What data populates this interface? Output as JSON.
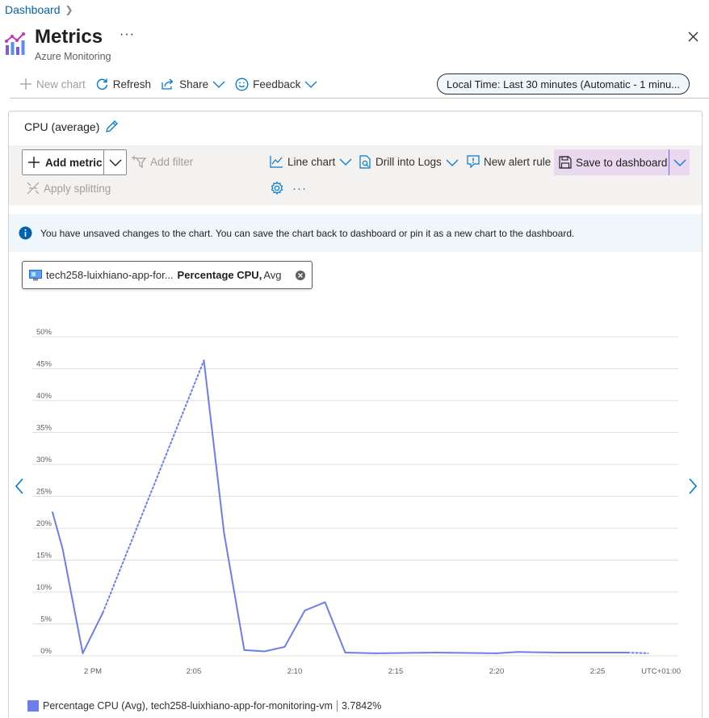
{
  "breadcrumb": {
    "item": "Dashboard"
  },
  "header": {
    "title": "Metrics",
    "subtitle": "Azure Monitoring",
    "more": "···"
  },
  "commandbar": {
    "new_chart": "New chart",
    "refresh": "Refresh",
    "share": "Share",
    "feedback": "Feedback",
    "time_range": "Local Time: Last 30 minutes (Automatic - 1 minu..."
  },
  "chart_card": {
    "title": "CPU (average)",
    "toolbar": {
      "add_metric": "Add metric",
      "add_filter": "Add filter",
      "line_chart": "Line chart",
      "drill_into_logs": "Drill into Logs",
      "new_alert_rule": "New alert rule",
      "save_to_dashboard": "Save to dashboard",
      "apply_splitting": "Apply splitting",
      "more": "···"
    },
    "banner": "You have unsaved changes to the chart. You can save the chart back to dashboard or pin it as a new chart to the dashboard.",
    "metric_pill": {
      "resource": "tech258-luixhiano-app-for...",
      "metric": "Percentage CPU,",
      "aggregation": "Avg"
    },
    "legend": {
      "label": "Percentage CPU (Avg), tech258-luixhiano-app-for-monitoring-vm",
      "value": "3.7842%"
    },
    "colors": {
      "series": "#6c7eea",
      "accent": "#0078d4",
      "banner_bg": "#eff6fc"
    }
  },
  "chart_data": {
    "type": "line",
    "ylim": [
      0,
      50
    ],
    "yticks": [
      "0%",
      "5%",
      "10%",
      "15%",
      "20%",
      "25%",
      "30%",
      "35%",
      "40%",
      "45%",
      "50%"
    ],
    "xticks": [
      "2 PM",
      "2:05",
      "2:10",
      "2:15",
      "2:20",
      "2:25"
    ],
    "timezone": "UTC+01:00",
    "series": [
      {
        "name": "Percentage CPU (Avg)",
        "points": [
          {
            "t": "1:58",
            "v": 22.5,
            "gap": false
          },
          {
            "t": "1:58.5",
            "v": 16.8,
            "gap": false
          },
          {
            "t": "1:59.5",
            "v": 0.4,
            "gap": false
          },
          {
            "t": "2:00.5",
            "v": 6.8,
            "gap": false
          },
          {
            "t": "2:05.5",
            "v": 46.3,
            "gap": true
          },
          {
            "t": "2:06.5",
            "v": 19.2,
            "gap": false
          },
          {
            "t": "2:07.5",
            "v": 0.9,
            "gap": false
          },
          {
            "t": "2:08.5",
            "v": 0.7,
            "gap": false
          },
          {
            "t": "2:09.5",
            "v": 1.4,
            "gap": false
          },
          {
            "t": "2:10.5",
            "v": 7.1,
            "gap": false
          },
          {
            "t": "2:11.5",
            "v": 8.4,
            "gap": false
          },
          {
            "t": "2:12.5",
            "v": 0.5,
            "gap": false
          },
          {
            "t": "2:14",
            "v": 0.4,
            "gap": false
          },
          {
            "t": "2:17",
            "v": 0.5,
            "gap": false
          },
          {
            "t": "2:20",
            "v": 0.4,
            "gap": false
          },
          {
            "t": "2:21",
            "v": 0.6,
            "gap": false
          },
          {
            "t": "2:23",
            "v": 0.5,
            "gap": false
          },
          {
            "t": "2:25.5",
            "v": 0.5,
            "gap": false
          },
          {
            "t": "2:26.5",
            "v": 0.5,
            "gap": false
          },
          {
            "t": "2:27.5",
            "v": 0.4,
            "gap": true
          }
        ]
      }
    ]
  }
}
